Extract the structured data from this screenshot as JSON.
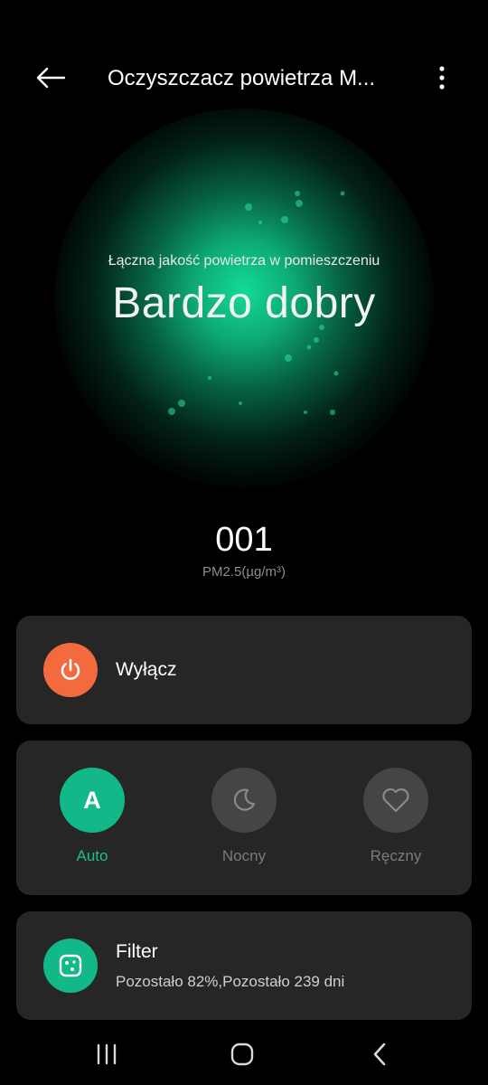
{
  "header": {
    "title": "Oczyszczacz powietrza M...",
    "back_icon": "arrow-left-icon",
    "menu_icon": "more-vertical-icon"
  },
  "air_quality": {
    "label": "Łączna jakość powietrza w pomieszczeniu",
    "value": "Bardzo dobry"
  },
  "pm": {
    "value": "001",
    "unit": "PM2.5(µg/m³)"
  },
  "power": {
    "label": "Wyłącz",
    "icon": "power-icon"
  },
  "modes": {
    "items": [
      {
        "label": "Auto",
        "icon_letter": "A",
        "active": true
      },
      {
        "label": "Nocny",
        "icon": "moon-icon",
        "active": false
      },
      {
        "label": "Ręczny",
        "icon": "heart-icon",
        "active": false
      }
    ]
  },
  "filter": {
    "title": "Filter",
    "status": "Pozostało 82%,Pozostało 239 dni",
    "icon": "filter-icon"
  },
  "colors": {
    "background": "#000000",
    "card": "#262626",
    "accent": "#13b889",
    "power": "#f26a3d",
    "inactive_circle": "#454545"
  },
  "navbar": {
    "recents_icon": "recents-icon",
    "home_icon": "home-icon",
    "back_icon": "nav-back-icon"
  }
}
